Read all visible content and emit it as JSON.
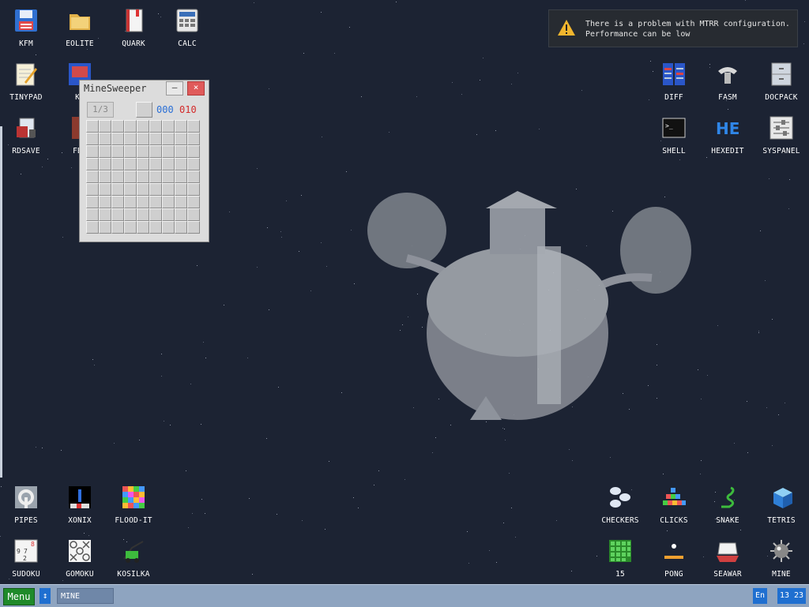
{
  "notification": {
    "line1": "There is a problem with MTRR configuration.",
    "line2": "Performance can be low"
  },
  "desktop_icons": {
    "kfm": "KFM",
    "eolite": "EOLITE",
    "quark": "QUARK",
    "calc": "CALC",
    "tinypad": "TINYPAD",
    "kf": "KF",
    "rdsave": "RDSAVE",
    "fb2": "FB2",
    "diff": "DIFF",
    "fasm": "FASM",
    "docpack": "DOCPACK",
    "shell": "SHELL",
    "hexedit": "HEXEDIT",
    "syspanel": "SYSPANEL",
    "pipes": "PIPES",
    "xonix": "XONIX",
    "flood_it": "FLOOD-IT",
    "sudoku": "SUDOKU",
    "gomoku": "GOMOKU",
    "kosilka": "KOSILKA",
    "checkers": "CHECKERS",
    "clicks": "CLICKS",
    "snake": "SNAKE",
    "tetris": "TETRIS",
    "n15": "15",
    "pong": "PONG",
    "seawar": "SEAWAR",
    "mine": "MINE"
  },
  "minesweeper": {
    "title": "MineSweeper",
    "minimize": "–",
    "close": "×",
    "level": "1/3",
    "flags": "000",
    "time": "010"
  },
  "taskbar": {
    "menu": "Menu",
    "arrow": "↕",
    "task": "MINE",
    "lang": "En",
    "clock": "13 23"
  },
  "colors": {
    "desktop": "#1c2333",
    "taskbar": "#8ea4c0",
    "menu_button": "#1f8a2a",
    "accent_blue": "#1f6fd0"
  }
}
